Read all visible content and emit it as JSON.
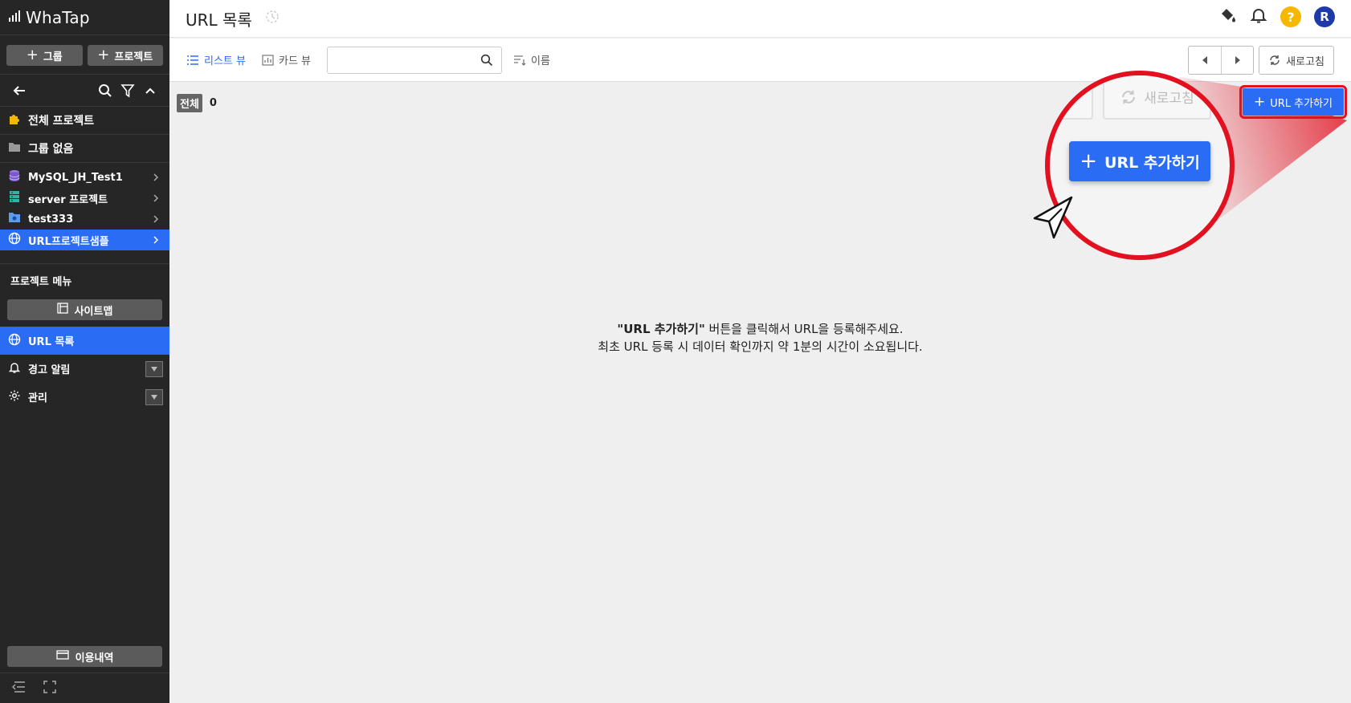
{
  "brand": {
    "name": "WhaTap"
  },
  "sidebar": {
    "group_button": "그룹",
    "project_button": "프로젝트",
    "all_projects": "전체 프로젝트",
    "no_group": "그룹 없음",
    "projects": [
      {
        "name": "MySQL_JH_Test1",
        "icon": "database-icon"
      },
      {
        "name": "server 프로젝트",
        "icon": "server-icon"
      },
      {
        "name": "test333",
        "icon": "folder-gear-icon"
      },
      {
        "name": "URL프로젝트샘플",
        "icon": "globe-icon",
        "active": true
      }
    ],
    "menu_title": "프로젝트 메뉴",
    "sitemap_button": "사이트맵",
    "menu": [
      {
        "name": "URL 목록",
        "icon": "globe-icon",
        "active": true
      },
      {
        "name": "경고 알림",
        "icon": "bell-icon"
      },
      {
        "name": "관리",
        "icon": "gear-icon"
      }
    ],
    "usage_button": "이용내역"
  },
  "header": {
    "title": "URL 목록"
  },
  "toolbar": {
    "list_view": "리스트 뷰",
    "card_view": "카드 뷰",
    "search_value": "",
    "sort_label": "이름",
    "refresh": "새로고침"
  },
  "content": {
    "total_label": "전체",
    "total_count": "0",
    "add_button": "URL 추가하기",
    "empty_bold": "\"URL 추가하기\"",
    "empty_line1": " 버튼을 클릭해서 URL을 등록해주세요.",
    "empty_line2": "최초 URL 등록 시 데이터 확인까지 약 1분의 시간이 소요됩니다."
  },
  "zoom": {
    "refresh": "새로고침",
    "add_button": "URL 추가하기"
  },
  "colors": {
    "sidebar_bg": "#262626",
    "accent": "#2b6cf5",
    "highlight": "#e3101f",
    "help": "#f5b700",
    "avatar": "#1e3aa8"
  },
  "user": {
    "initial": "R"
  }
}
